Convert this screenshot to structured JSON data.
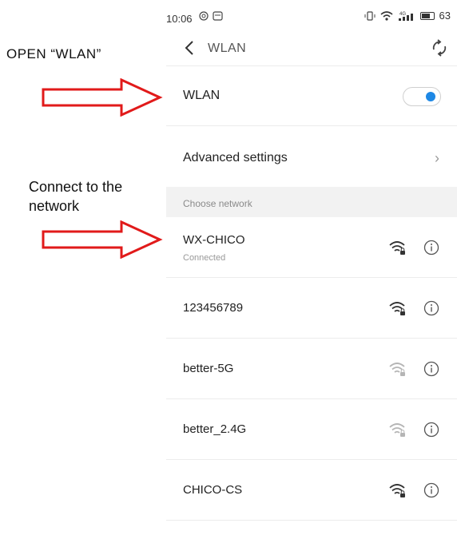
{
  "annotations": {
    "open_text": "OPEN “WLAN”",
    "connect_line1": "Connect to the",
    "connect_line2": "network"
  },
  "status_bar": {
    "time": "10:06",
    "battery": "63"
  },
  "top_bar": {
    "title": "WLAN"
  },
  "wlan_toggle": {
    "label": "WLAN",
    "on": true
  },
  "advanced": {
    "label": "Advanced settings"
  },
  "section": {
    "label": "Choose network"
  },
  "networks": [
    {
      "name": "WX-CHICO",
      "status": "Connected",
      "signal": "strong"
    },
    {
      "name": "123456789",
      "signal": "strong"
    },
    {
      "name": "better-5G",
      "signal": "weak"
    },
    {
      "name": "better_2.4G",
      "signal": "weak"
    },
    {
      "name": "CHICO-CS",
      "signal": "strong"
    }
  ],
  "colors": {
    "accent": "#1e88e5",
    "arrow": "#e11a1a",
    "icon_strong": "#333333",
    "icon_weak": "#b5b5b5"
  }
}
